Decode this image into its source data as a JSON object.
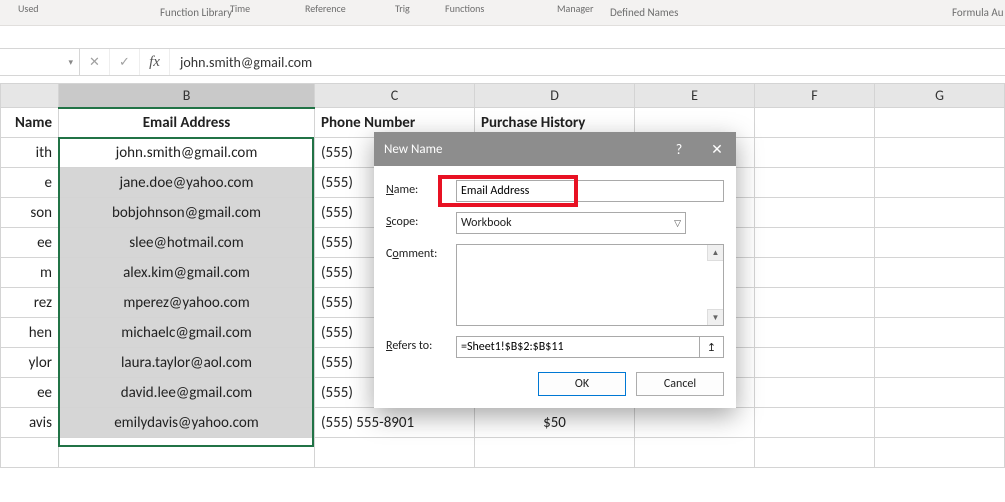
{
  "ribbon": {
    "used": "Used",
    "time": "Time",
    "reference": "Reference",
    "trig": "Trig",
    "functions": "Functions",
    "function_library": "Function Library",
    "manager": "Manager",
    "defined_names": "Defined Names",
    "remove": "",
    "formula_au": "Formula Au"
  },
  "formula_bar": {
    "name_box": "",
    "cancel_glyph": "✕",
    "enter_glyph": "✓",
    "fx_glyph": "fx",
    "value": "john.smith@gmail.com"
  },
  "columns": [
    "Name",
    "B",
    "C",
    "D",
    "E",
    "F",
    "G"
  ],
  "headers": {
    "A": "Name",
    "B": "Email Address",
    "C": "Phone Number",
    "D": "Purchase History"
  },
  "rows": [
    {
      "name": "ith",
      "email": "john.smith@gmail.com",
      "phone": "(555)",
      "purchase": ""
    },
    {
      "name": "e",
      "email": "jane.doe@yahoo.com",
      "phone": "(555)",
      "purchase": ""
    },
    {
      "name": "son",
      "email": "bobjohnson@gmail.com",
      "phone": "(555)",
      "purchase": ""
    },
    {
      "name": "ee",
      "email": "slee@hotmail.com",
      "phone": "(555)",
      "purchase": ""
    },
    {
      "name": "m",
      "email": "alex.kim@gmail.com",
      "phone": "(555)",
      "purchase": ""
    },
    {
      "name": "rez",
      "email": "mperez@yahoo.com",
      "phone": "(555)",
      "purchase": ""
    },
    {
      "name": "hen",
      "email": "michaelc@gmail.com",
      "phone": "(555)",
      "purchase": ""
    },
    {
      "name": "ylor",
      "email": "laura.taylor@aol.com",
      "phone": "(555)",
      "purchase": ""
    },
    {
      "name": "ee",
      "email": "david.lee@gmail.com",
      "phone": "(555)",
      "purchase": ""
    },
    {
      "name": "avis",
      "email": "emilydavis@yahoo.com",
      "phone": "(555) 555-8901",
      "purchase": "$50"
    }
  ],
  "dialog": {
    "title": "New Name",
    "help_glyph": "?",
    "close_glyph": "✕",
    "name_label_pre": "N",
    "name_label_post": "ame:",
    "name_value": "Email Address",
    "scope_label_pre": "S",
    "scope_label_post": "cope:",
    "scope_value": "Workbook",
    "comment_label_pre": "C",
    "comment_label_post": "omment:",
    "comment_underline": "o",
    "refersto_label_pre": "R",
    "refersto_label_post": "efers to:",
    "refersto_value": "=Sheet1!$B$2:$B$11",
    "ref_btn_glyph": "↥",
    "ok_label": "OK",
    "cancel_label": "Cancel"
  }
}
